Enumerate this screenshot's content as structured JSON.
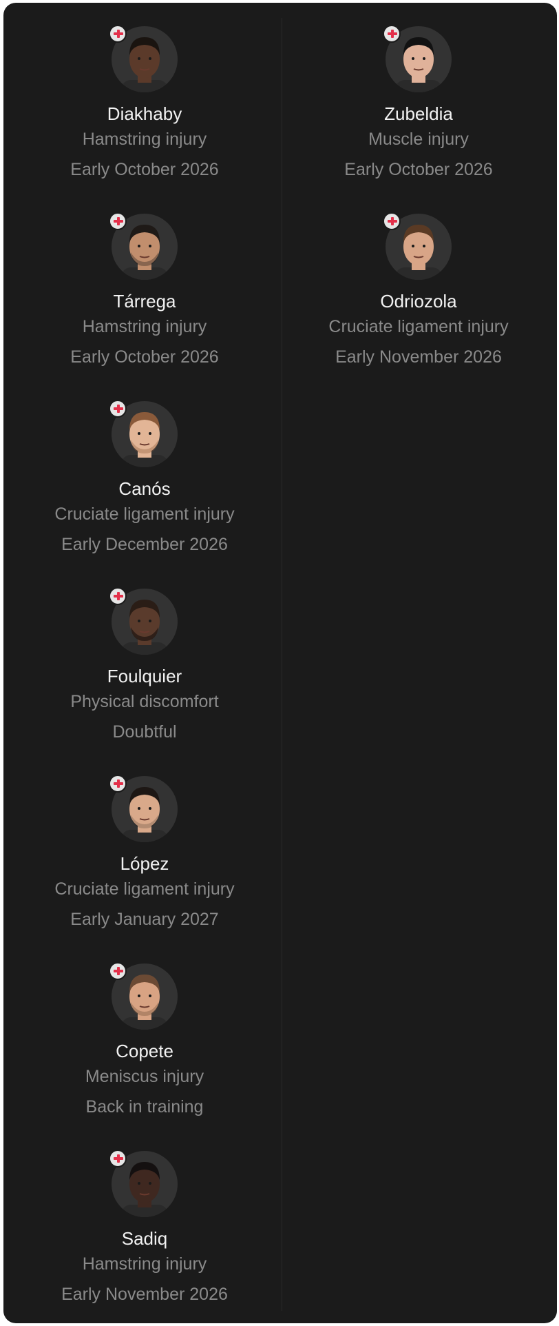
{
  "colors": {
    "panel_background": "#1b1b1b",
    "divider": "#2b2b2b",
    "name_text": "#f2f2f2",
    "secondary_text": "#8a8a8a",
    "avatar_background": "#333333",
    "injury_badge_cross": "#e4304a",
    "injury_badge_background": "#e6e6e6"
  },
  "icons": {
    "badge": "medical-cross-icon"
  },
  "columns": [
    {
      "players": [
        {
          "name": "Diakhaby",
          "injury": "Hamstring injury",
          "return": "Early October 2026",
          "skin": "#5b3a2a",
          "hair": "#1a1410",
          "beard": "none"
        },
        {
          "name": "Tárrega",
          "injury": "Hamstring injury",
          "return": "Early October 2026",
          "skin": "#c18e6d",
          "hair": "#1f1a17",
          "beard": "stubble"
        },
        {
          "name": "Canós",
          "injury": "Cruciate ligament injury",
          "return": "Early December 2026",
          "skin": "#e2b596",
          "hair": "#8a5a3a",
          "beard": "stubble"
        },
        {
          "name": "Foulquier",
          "injury": "Physical discomfort",
          "return": "Doubtful",
          "skin": "#5a3b2c",
          "hair": "#2a1d16",
          "beard": "full"
        },
        {
          "name": "López",
          "injury": "Cruciate ligament injury",
          "return": "Early January 2027",
          "skin": "#d9a98a",
          "hair": "#1d1714",
          "beard": "mustache"
        },
        {
          "name": "Copete",
          "injury": "Meniscus injury",
          "return": "Back in training",
          "skin": "#d8a383",
          "hair": "#6b4a34",
          "beard": "stubble"
        },
        {
          "name": "Sadiq",
          "injury": "Hamstring injury",
          "return": "Early November 2026",
          "skin": "#3f2820",
          "hair": "#141010",
          "beard": "none"
        }
      ]
    },
    {
      "players": [
        {
          "name": "Zubeldia",
          "injury": "Muscle injury",
          "return": "Early October 2026",
          "skin": "#e0b29a",
          "hair": "#121212",
          "beard": "none"
        },
        {
          "name": "Odriozola",
          "injury": "Cruciate ligament injury",
          "return": "Early November 2026",
          "skin": "#d8a587",
          "hair": "#5a3a24",
          "beard": "none"
        }
      ]
    }
  ]
}
